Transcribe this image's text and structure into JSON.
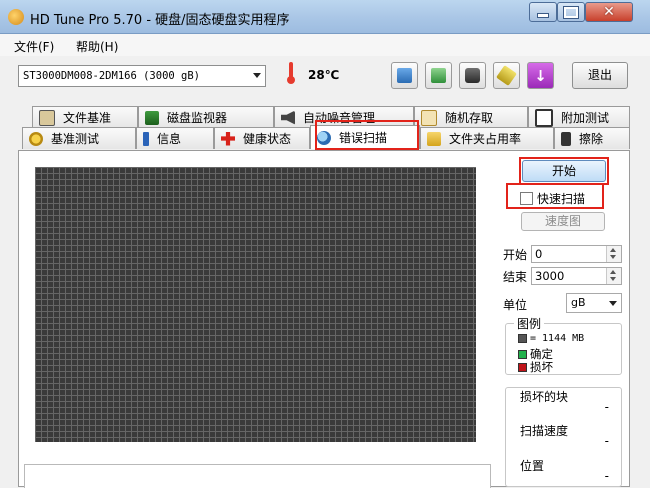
{
  "window": {
    "title": "HD Tune Pro 5.70 - 硬盘/固态硬盘实用程序"
  },
  "menu": {
    "file": "文件(F)",
    "help": "帮助(H)"
  },
  "toolbar": {
    "drive": "ST3000DM008-2DM166 (3000 gB)",
    "temperature": "28℃",
    "exit_label": "退出",
    "icons": [
      "copy-icon",
      "save-icon",
      "camera-icon",
      "options-icon",
      "download-icon"
    ]
  },
  "tabs": {
    "row1": [
      "文件基准",
      "磁盘监视器",
      "自动噪音管理",
      "随机存取",
      "附加测试"
    ],
    "row2": [
      "基准测试",
      "信息",
      "健康状态",
      "错误扫描",
      "文件夹占用率",
      "擦除"
    ],
    "active": "错误扫描"
  },
  "scan": {
    "start_label": "开始",
    "quick_scan_label": "快速扫描",
    "quick_scan_checked": false,
    "speed_map_label": "速度图",
    "start_field_label": "开始",
    "start_value": "0",
    "end_field_label": "结束",
    "end_value": "3000",
    "unit_label": "单位",
    "unit_value": "gB"
  },
  "legend": {
    "title": "图例",
    "block_size": "= 1144 MB",
    "ok_label": "确定",
    "damaged_label": "损坏",
    "colors": {
      "ok": "#22b14c",
      "damaged": "#c0141a",
      "block": "#555555"
    }
  },
  "stats": {
    "damaged_blocks_label": "损坏的块",
    "damaged_blocks_value": "-",
    "scan_speed_label": "扫描速度",
    "scan_speed_value": "-",
    "position_label": "位置",
    "position_value": "-"
  }
}
